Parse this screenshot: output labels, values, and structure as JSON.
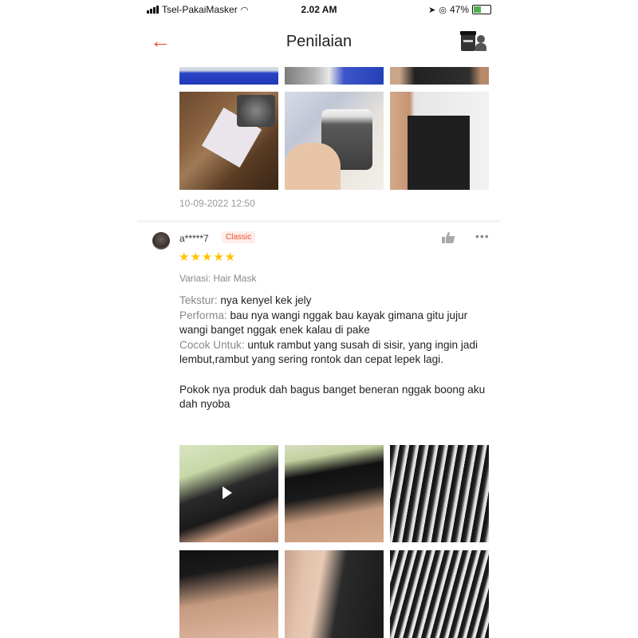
{
  "status_bar": {
    "carrier": "Tsel-PakaiMasker",
    "time": "2.02 AM",
    "battery": "47%",
    "battery_level": 0.47
  },
  "header": {
    "title": "Penilaian"
  },
  "previous_review": {
    "date": "10-09-2022 12:50"
  },
  "review": {
    "username": "a*****7",
    "badge": "Classic",
    "rating": 5,
    "stars": "★★★★★",
    "variant": "Variasi: Hair Mask",
    "texture_label": "Tekstur:",
    "texture_text": " nya kenyel kek jely",
    "performance_label": "Performa:",
    "performance_text": " bau nya wangi nggak bau kayak gimana gitu jujur wangi banget nggak enek kalau di pake",
    "suitable_label": "Cocok Untuk:",
    "suitable_text": " untuk rambut yang susah di sisir, yang ingin jadi lembut,rambut yang sering rontok dan cepat lepek lagi.",
    "closing": "Pokok nya produk dah bagus banget beneran nggak boong aku dah nyoba"
  },
  "colors": {
    "accent": "#ee4d2d",
    "star": "#ffc200",
    "muted": "#888888"
  },
  "icons": {
    "back": "back-arrow-icon",
    "cart": "product-thumbnail-icon",
    "like": "thumbs-up-icon",
    "more": "more-dots-icon",
    "play": "play-icon"
  }
}
